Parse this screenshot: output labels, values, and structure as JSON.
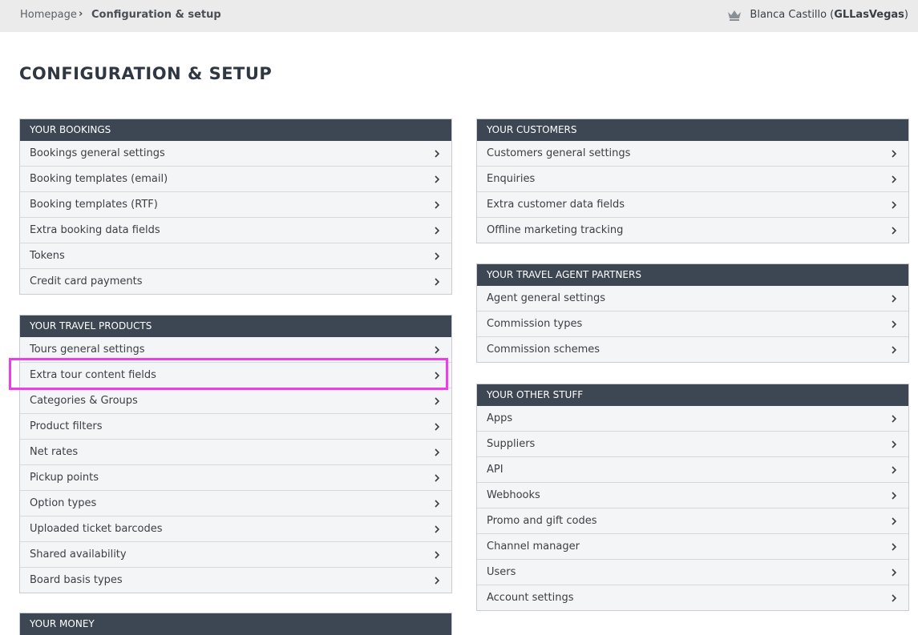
{
  "breadcrumb": {
    "home": "Homepage",
    "separator": "›",
    "current": "Configuration & setup"
  },
  "user": {
    "name": "Blanca Castillo",
    "org_open": "(",
    "org": "GLLasVegas",
    "org_close": ")",
    "icon": "crown-icon"
  },
  "page_title": "CONFIGURATION & SETUP",
  "sections": {
    "bookings": {
      "title": "YOUR BOOKINGS",
      "items": [
        "Bookings general settings",
        "Booking templates (email)",
        "Booking templates (RTF)",
        "Extra booking data fields",
        "Tokens",
        "Credit card payments"
      ]
    },
    "travel_products": {
      "title": "YOUR TRAVEL PRODUCTS",
      "items": [
        "Tours general settings",
        "Extra tour content fields",
        "Categories & Groups",
        "Product filters",
        "Net rates",
        "Pickup points",
        "Option types",
        "Uploaded ticket barcodes",
        "Shared availability",
        "Board basis types"
      ]
    },
    "money": {
      "title": "YOUR MONEY"
    },
    "customers": {
      "title": "YOUR CUSTOMERS",
      "items": [
        "Customers general settings",
        "Enquiries",
        "Extra customer data fields",
        "Offline marketing tracking"
      ]
    },
    "agent_partners": {
      "title": "YOUR TRAVEL AGENT PARTNERS",
      "items": [
        "Agent general settings",
        "Commission types",
        "Commission schemes"
      ]
    },
    "other_stuff": {
      "title": "YOUR OTHER STUFF",
      "items": [
        "Apps",
        "Suppliers",
        "API",
        "Webhooks",
        "Promo and gift codes",
        "Channel manager",
        "Users",
        "Account settings"
      ]
    }
  },
  "colors": {
    "header_bg": "#3d4754",
    "highlight": "#ee3ee9",
    "topbar_bg": "#ebebeb"
  }
}
